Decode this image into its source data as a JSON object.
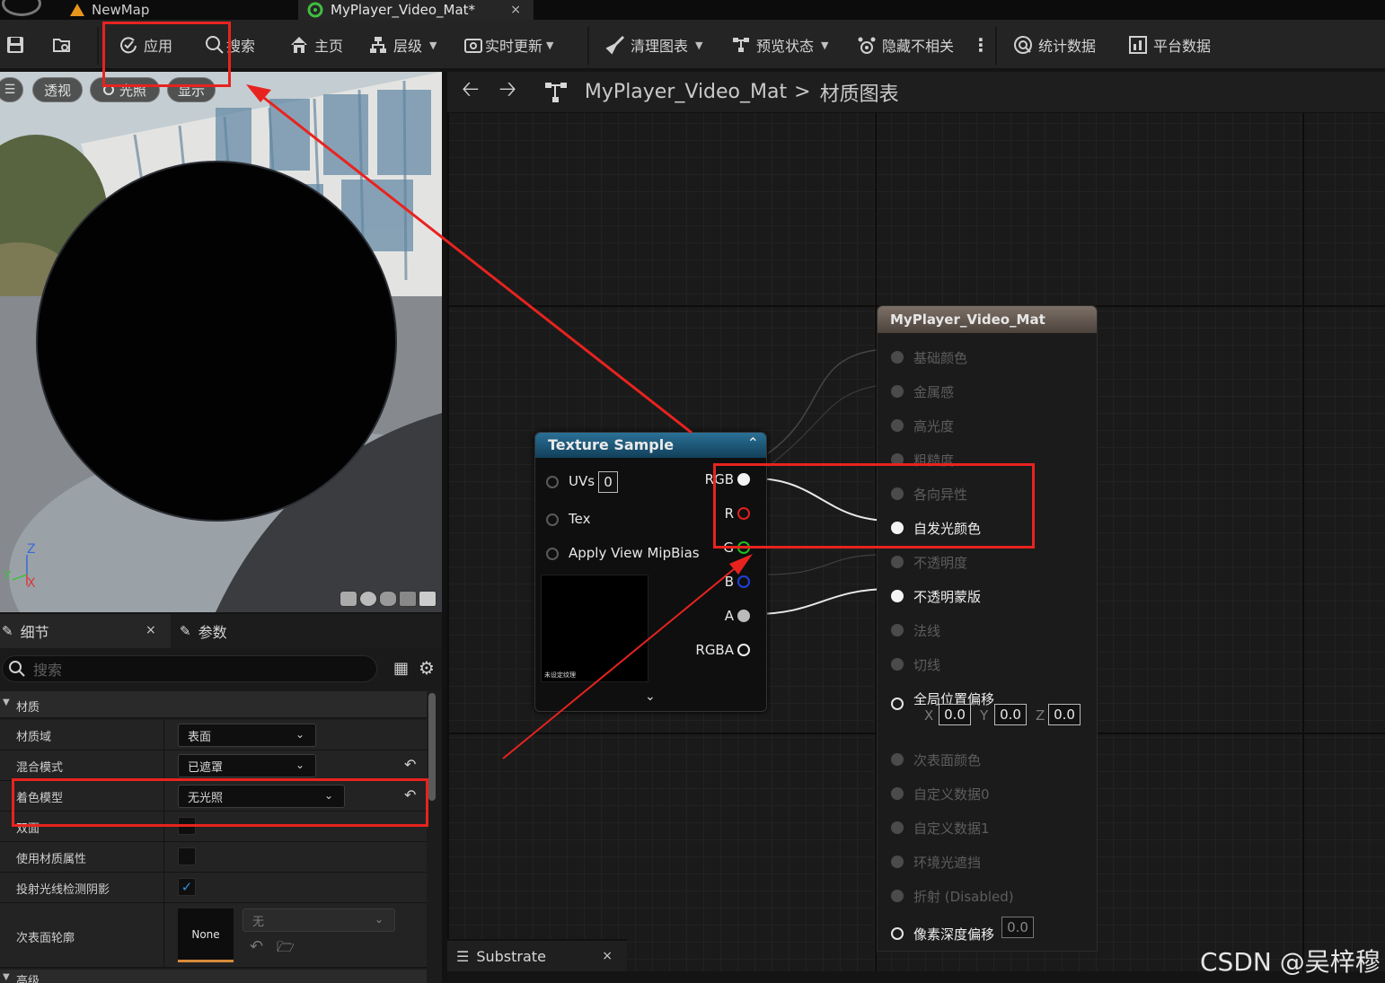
{
  "tabs": [
    {
      "label": "NewMap"
    },
    {
      "label": "MyPlayer_Video_Mat*",
      "close": "×"
    }
  ],
  "toolbar": {
    "apply": "应用",
    "search": "搜索",
    "home": "主页",
    "hierarchy": "层级",
    "live_update": "实时更新",
    "clean_graph": "清理图表",
    "preview_state": "预览状态",
    "hide_unrelated": "隐藏不相关",
    "stats": "统计数据",
    "platform_stats": "平台数据"
  },
  "viewport": {
    "perspective": "透视",
    "lighting": "光照",
    "show": "显示",
    "axis_z": "Z",
    "axis_y": "Y",
    "axis_x": "X"
  },
  "graph": {
    "breadcrumb_asset": "MyPlayer_Video_Mat",
    "breadcrumb_sep": ">",
    "breadcrumb_graph": "材质图表",
    "texture_node": {
      "title": "Texture Sample",
      "inputs": [
        "UVs",
        "Tex",
        "Apply View MipBias"
      ],
      "uvs_value": "0",
      "outputs": [
        "RGB",
        "R",
        "G",
        "B",
        "A",
        "RGBA"
      ],
      "preview_caption": "未设定纹理"
    },
    "material_node": {
      "title": "MyPlayer_Video_Mat",
      "inputs": [
        {
          "label": "基础颜色",
          "active": false
        },
        {
          "label": "金属感",
          "active": false
        },
        {
          "label": "高光度",
          "active": false
        },
        {
          "label": "粗糙度",
          "active": false
        },
        {
          "label": "各向异性",
          "active": false
        },
        {
          "label": "自发光颜色",
          "active": true
        },
        {
          "label": "不透明度",
          "active": false
        },
        {
          "label": "不透明蒙版",
          "active": true
        },
        {
          "label": "法线",
          "active": false
        },
        {
          "label": "切线",
          "active": false
        },
        {
          "label": "全局位置偏移",
          "active": true
        },
        {
          "label": "次表面颜色",
          "active": false
        },
        {
          "label": "自定义数据0",
          "active": false
        },
        {
          "label": "自定义数据1",
          "active": false
        },
        {
          "label": "环境光遮挡",
          "active": false
        },
        {
          "label": "折射 (Disabled)",
          "active": false
        },
        {
          "label": "像素深度偏移",
          "active": true
        }
      ],
      "wpo": {
        "x_label": "X",
        "x": "0.0",
        "y_label": "Y",
        "y": "0.0",
        "z_label": "Z",
        "z": "0.0"
      },
      "pdo_value": "0.0"
    },
    "substrate_tab": "Substrate",
    "substrate_close": "×"
  },
  "details": {
    "tab_details": "细节",
    "tab_details_close": "×",
    "tab_params": "参数",
    "search_placeholder": "搜索",
    "section_material": "材质",
    "section_advanced": "高级",
    "rows": {
      "domain_label": "材质域",
      "domain_value": "表面",
      "blend_label": "混合模式",
      "blend_value": "已遮罩",
      "shading_label": "着色模型",
      "shading_value": "无光照",
      "twosided_label": "双面",
      "use_attrs_label": "使用材质属性",
      "raytrace_label": "投射光线检测阴影",
      "raytrace_checked": true,
      "subsurface_label": "次表面轮廓",
      "subsurface_thumb": "None",
      "subsurface_value": "无"
    }
  },
  "watermark": "CSDN @吴梓穆",
  "colors": {
    "annotation_red": "#e8231f",
    "node_header_texture": "#1e5a78",
    "node_header_material": "#6a5e56"
  }
}
